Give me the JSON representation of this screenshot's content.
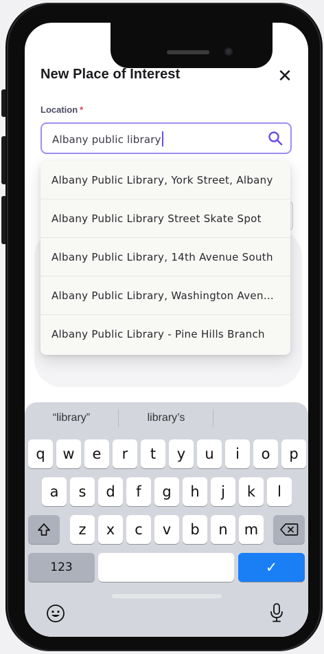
{
  "form": {
    "title": "New Place of Interest",
    "close_label": "✕",
    "location_label": "Location",
    "required_mark": "*",
    "search_value": "Albany public library"
  },
  "suggestions": [
    "Albany Public Library, York Street, Albany",
    "Albany Public Library Street Skate Spot",
    "Albany Public Library, 14th Avenue South",
    "Albany Public Library, Washington Avenue",
    "Albany Public Library - Pine Hills Branch"
  ],
  "keyboard": {
    "predictions": [
      "“library”",
      "library’s",
      ""
    ],
    "row1": [
      "q",
      "w",
      "e",
      "r",
      "t",
      "y",
      "u",
      "i",
      "o",
      "p"
    ],
    "row2": [
      "a",
      "s",
      "d",
      "f",
      "g",
      "h",
      "j",
      "k",
      "l"
    ],
    "row3": [
      "z",
      "x",
      "c",
      "v",
      "b",
      "n",
      "m"
    ],
    "numbers_label": "123",
    "space_label": "",
    "submit_label": "✓"
  },
  "colors": {
    "accent": "#9d8ef0",
    "required": "#d93a5b",
    "submit": "#1a7ef5"
  }
}
